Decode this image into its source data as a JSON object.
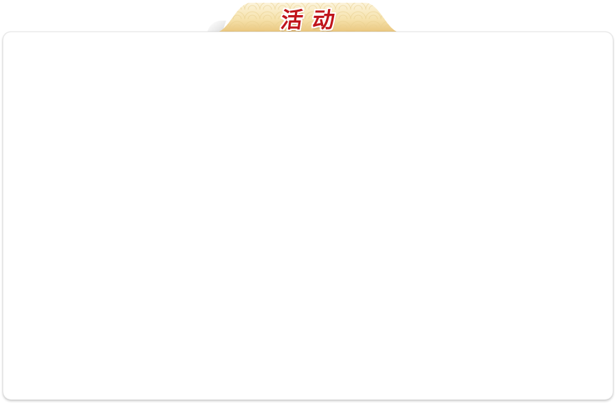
{
  "dialog": {
    "title": "活动"
  },
  "colors": {
    "title_text": "#c0141b",
    "tab_gold_light": "#fbf0cf",
    "tab_gold_dark": "#e9c47a",
    "panel_background": "#ffffff"
  }
}
